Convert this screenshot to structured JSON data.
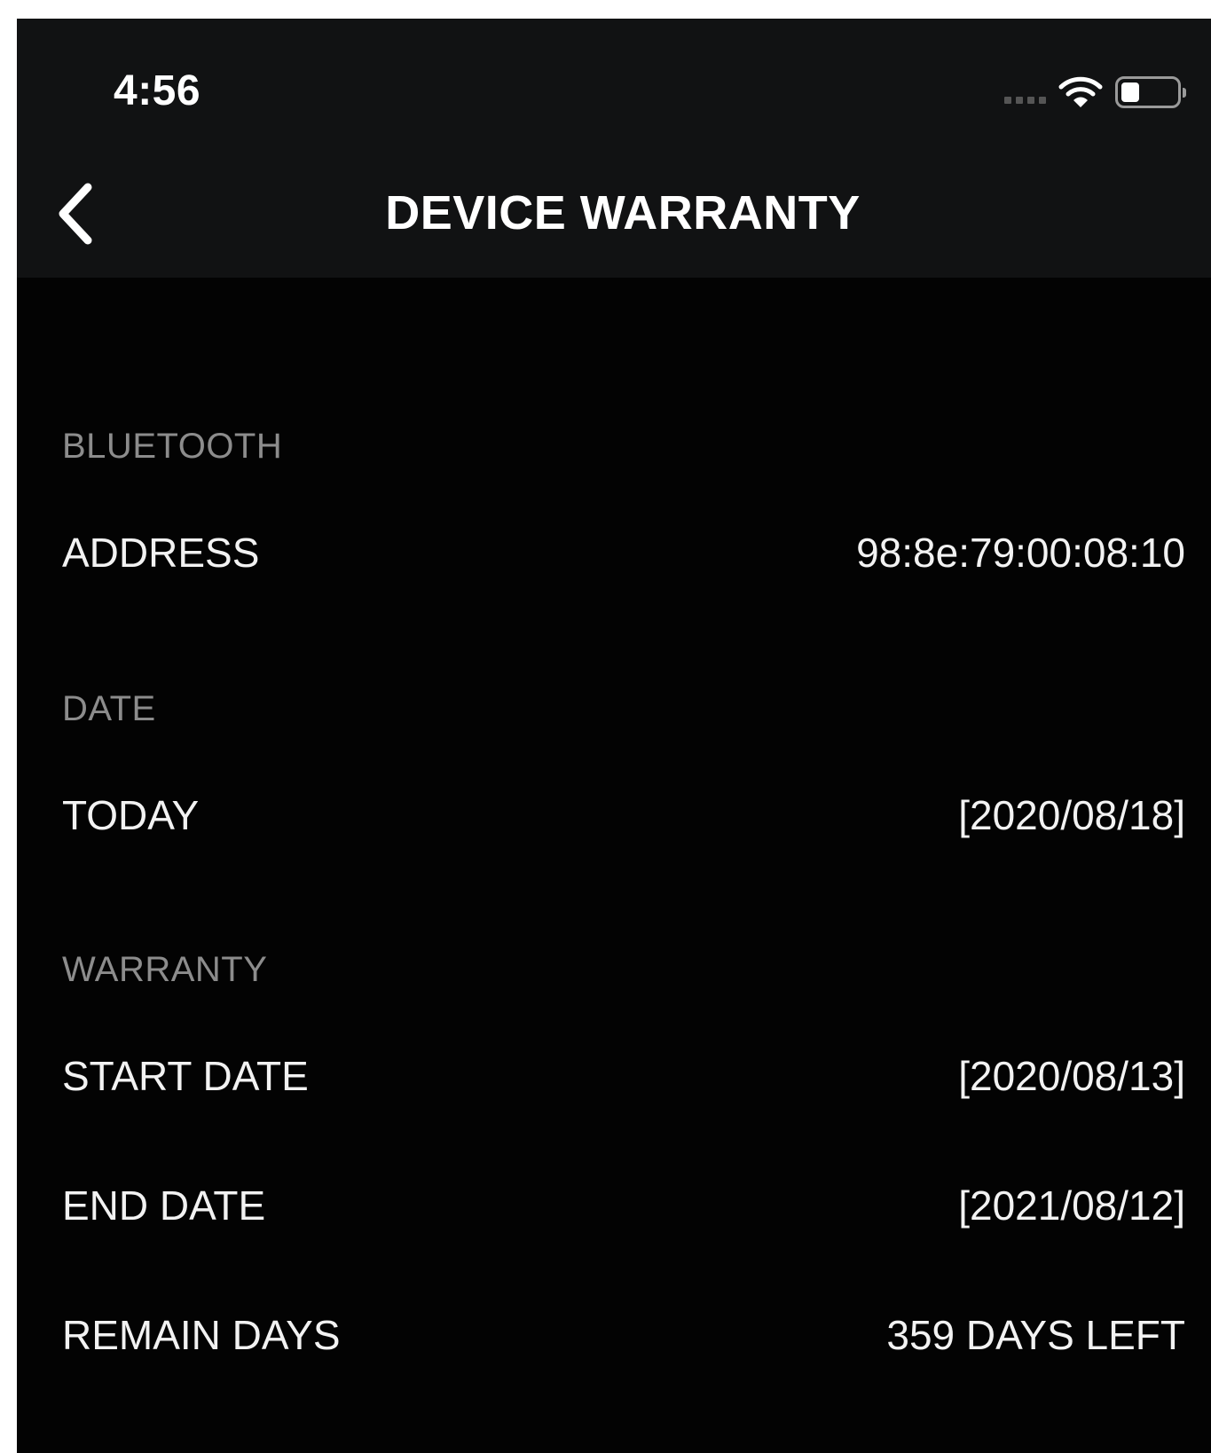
{
  "status_bar": {
    "time": "4:56"
  },
  "nav": {
    "title": "DEVICE WARRANTY",
    "back_icon": "chevron-left-icon"
  },
  "sections": {
    "bluetooth": {
      "header": "BLUETOOTH",
      "rows": [
        {
          "label": "ADDRESS",
          "value": "98:8e:79:00:08:10"
        }
      ]
    },
    "date": {
      "header": "DATE",
      "rows": [
        {
          "label": "TODAY",
          "value": "[2020/08/18]"
        }
      ]
    },
    "warranty": {
      "header": "WARRANTY",
      "rows": [
        {
          "label": "START DATE",
          "value": "[2020/08/13]"
        },
        {
          "label": "END DATE",
          "value": "[2021/08/12]"
        },
        {
          "label": "REMAIN DAYS",
          "value": "359 DAYS LEFT"
        }
      ]
    }
  },
  "colors": {
    "background": "#030303",
    "header_background": "#111213",
    "section_header_text": "#8c8c8c",
    "primary_text": "#f2f2f2"
  }
}
